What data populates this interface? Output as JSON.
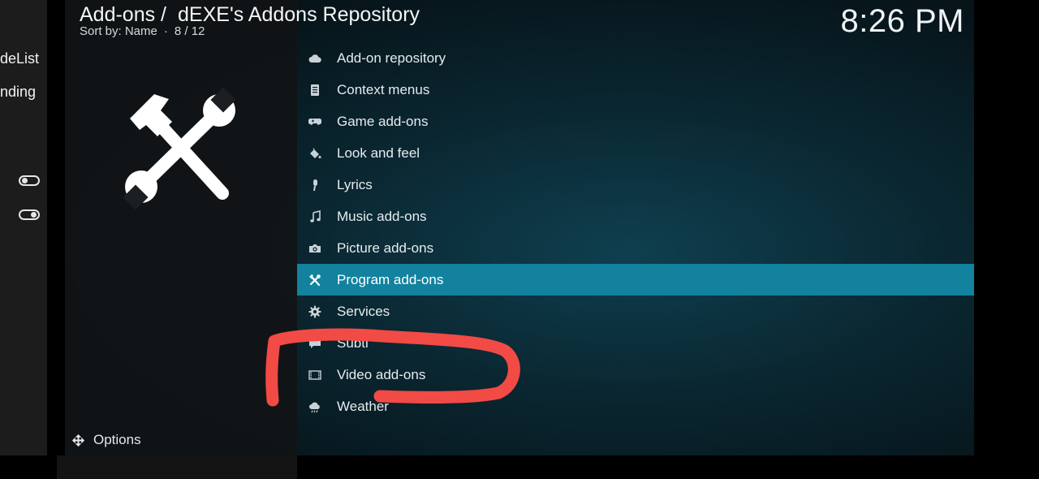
{
  "background_app": {
    "line1": "deList",
    "line2": "nding"
  },
  "header": {
    "title_part1": "Add-ons /",
    "title_part2": "dEXE's Addons Repository",
    "sort_label": "Sort by: Name",
    "separator": "·",
    "position": "8 / 12"
  },
  "clock": "8:26 PM",
  "hero_icon": "tools-icon",
  "footer": {
    "options_label": "Options"
  },
  "list": {
    "items": [
      {
        "label": "Add-on repository",
        "icon": "cloud-icon"
      },
      {
        "label": "Context menus",
        "icon": "context-menu-icon"
      },
      {
        "label": "Game add-ons",
        "icon": "gamepad-icon"
      },
      {
        "label": "Look and feel",
        "icon": "paint-bucket-icon"
      },
      {
        "label": "Lyrics",
        "icon": "microphone-icon"
      },
      {
        "label": "Music add-ons",
        "icon": "music-note-icon"
      },
      {
        "label": "Picture add-ons",
        "icon": "camera-icon"
      },
      {
        "label": "Program add-ons",
        "icon": "tools-icon",
        "selected": true
      },
      {
        "label": "Services",
        "icon": "gear-icon"
      },
      {
        "label": "Subti",
        "icon": "subtitles-icon"
      },
      {
        "label": "Video add-ons",
        "icon": "film-icon"
      },
      {
        "label": "Weather",
        "icon": "weather-icon"
      }
    ]
  },
  "colors": {
    "selection": "#12829f",
    "annotation_stroke": "#f24a45"
  }
}
